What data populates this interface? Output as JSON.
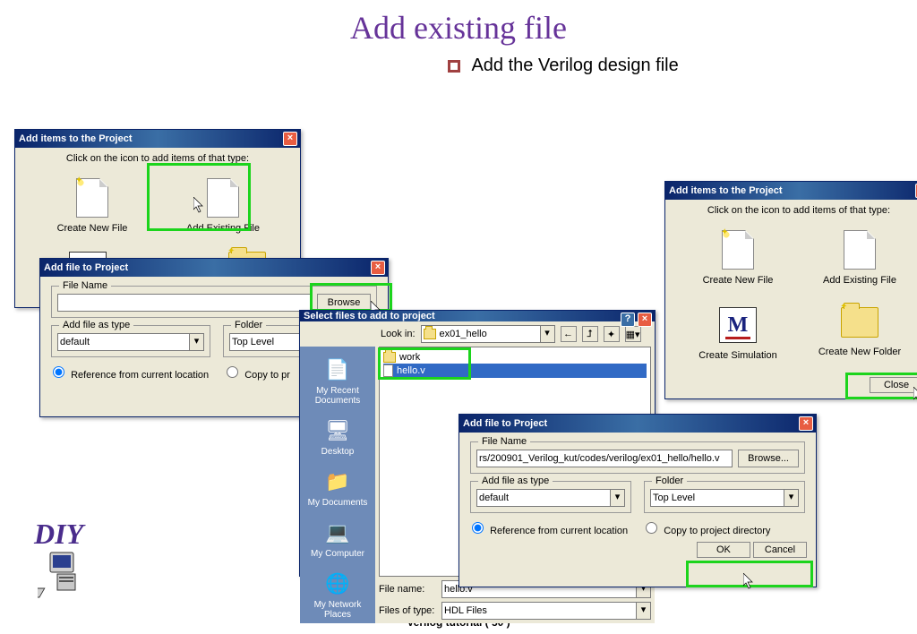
{
  "slide": {
    "title": "Add existing file",
    "subtitle": "Add the Verilog design file",
    "footer": "Verilog tutorial  ( 50 )",
    "diy": "DIY"
  },
  "add_items_1": {
    "title": "Add items to the Project",
    "instruction": "Click on the icon to add items of that type:",
    "create_new": "Create New File",
    "add_existing": "Add Existing File"
  },
  "add_file_1": {
    "title": "Add file to Project",
    "filename_legend": "File Name",
    "browse": "Browse",
    "add_as_legend": "Add file as type",
    "add_as_value": "default",
    "folder_legend": "Folder",
    "folder_value": "Top Level",
    "ref_option": "Reference from current location",
    "copy_option": "Copy to pr"
  },
  "select_files": {
    "title": "Select files to add to project",
    "lookin_label": "Look in:",
    "lookin_value": "ex01_hello",
    "side": {
      "recent": "My Recent Documents",
      "desktop": "Desktop",
      "mydocs": "My Documents",
      "mycomp": "My Computer",
      "network": "My Network Places"
    },
    "files": {
      "folder": "work",
      "file": "hello.v"
    },
    "filename_label": "File name:",
    "filename_value": "hello.v",
    "filetype_label": "Files of type:",
    "filetype_value": "HDL Files"
  },
  "add_file_2": {
    "title": "Add file to Project",
    "filename_legend": "File Name",
    "filename_value": "rs/200901_Verilog_kut/codes/verilog/ex01_hello/hello.v",
    "browse": "Browse...",
    "add_as_legend": "Add file as type",
    "add_as_value": "default",
    "folder_legend": "Folder",
    "folder_value": "Top Level",
    "ref_option": "Reference from current location",
    "copy_option": "Copy to project directory",
    "ok": "OK",
    "cancel": "Cancel"
  },
  "add_items_2": {
    "title": "Add items to the Project",
    "instruction": "Click on the icon to add items of that type:",
    "create_new": "Create New File",
    "add_existing": "Add Existing File",
    "create_sim": "Create Simulation",
    "create_folder": "Create New Folder",
    "close": "Close"
  }
}
